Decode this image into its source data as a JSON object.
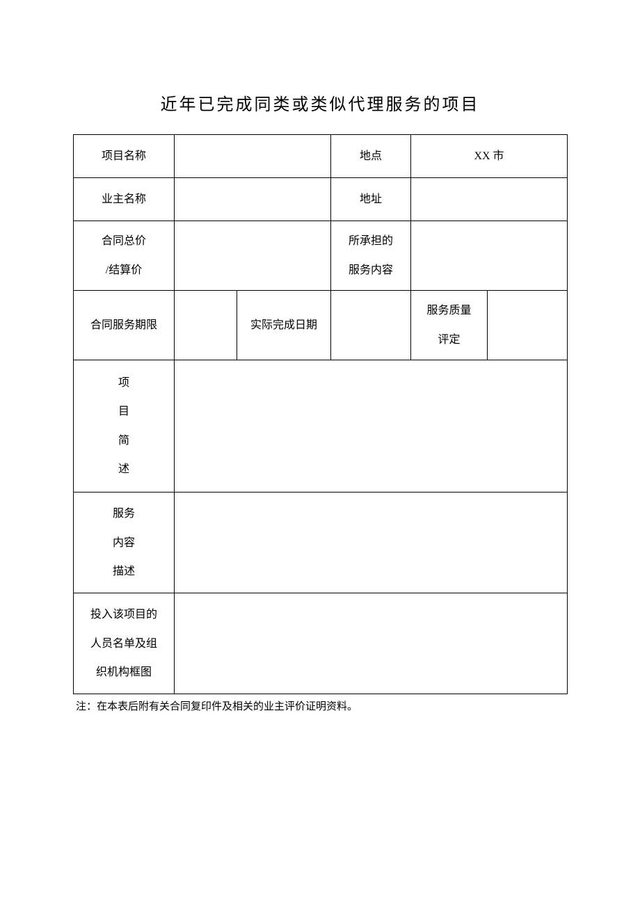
{
  "title": "近年已完成同类或类似代理服务的项目",
  "rows": {
    "r1": {
      "label1": "项目名称",
      "value1": "",
      "label2": "地点",
      "value2": "XX 市"
    },
    "r2": {
      "label1": "业主名称",
      "value1": "",
      "label2": "地址",
      "value2": ""
    },
    "r3": {
      "label1_line1": "合同总价",
      "label1_line2": "/结算价",
      "value1": "",
      "label2_line1": "所承担的",
      "label2_line2": "服务内容",
      "value2": ""
    },
    "r4": {
      "label1": "合同服务期限",
      "value1": "",
      "label2": "实际完成日期",
      "value2": "",
      "label3_line1": "服务质量",
      "label3_line2": "评定",
      "value3": ""
    },
    "r5": {
      "label_c1": "项",
      "label_c2": "目",
      "label_c3": "简",
      "label_c4": "述",
      "value": ""
    },
    "r6": {
      "label_line1": "服务",
      "label_line2": "内容",
      "label_line3": "描述",
      "value": ""
    },
    "r7": {
      "label_line1": "投入该项目的",
      "label_line2": "人员名单及组",
      "label_line3": "织机构框图",
      "value": ""
    }
  },
  "note": "注：在本表后附有关合同复印件及相关的业主评价证明资料。"
}
